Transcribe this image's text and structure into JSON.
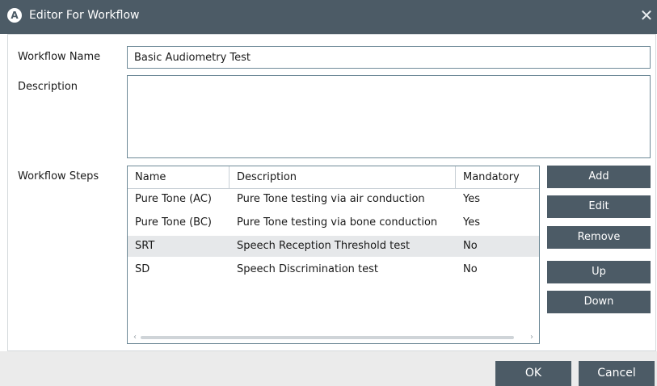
{
  "window": {
    "title": "Editor For Workflow",
    "logo_letter": "A",
    "close_glyph": "✕"
  },
  "form": {
    "workflow_name_label": "Workflow Name",
    "workflow_name_value": "Basic Audiometry Test",
    "description_label": "Description",
    "description_value": "",
    "workflow_steps_label": "Workflow Steps"
  },
  "steps_table": {
    "columns": [
      "Name",
      "Description",
      "Mandatory"
    ],
    "rows": [
      {
        "name": "Pure Tone (AC)",
        "description": "Pure Tone testing via air conduction",
        "mandatory": "Yes",
        "selected": false
      },
      {
        "name": "Pure Tone (BC)",
        "description": "Pure Tone testing via bone conduction",
        "mandatory": "Yes",
        "selected": false
      },
      {
        "name": "SRT",
        "description": "Speech Reception Threshold test",
        "mandatory": "No",
        "selected": true
      },
      {
        "name": "SD",
        "description": "Speech Discrimination test",
        "mandatory": "No",
        "selected": false
      }
    ],
    "scroll_left_glyph": "‹",
    "scroll_right_glyph": "›"
  },
  "side_buttons": {
    "add": "Add",
    "edit": "Edit",
    "remove": "Remove",
    "up": "Up",
    "down": "Down"
  },
  "footer": {
    "ok": "OK",
    "cancel": "Cancel"
  },
  "colors": {
    "accent": "#4c5b66",
    "selected_row": "#e6e8ea",
    "footer_bg": "#ebebeb"
  },
  "icons": {
    "logo": "app-logo-icon",
    "close": "close-icon",
    "scroll_left": "chevron-left-icon",
    "scroll_right": "chevron-right-icon"
  }
}
